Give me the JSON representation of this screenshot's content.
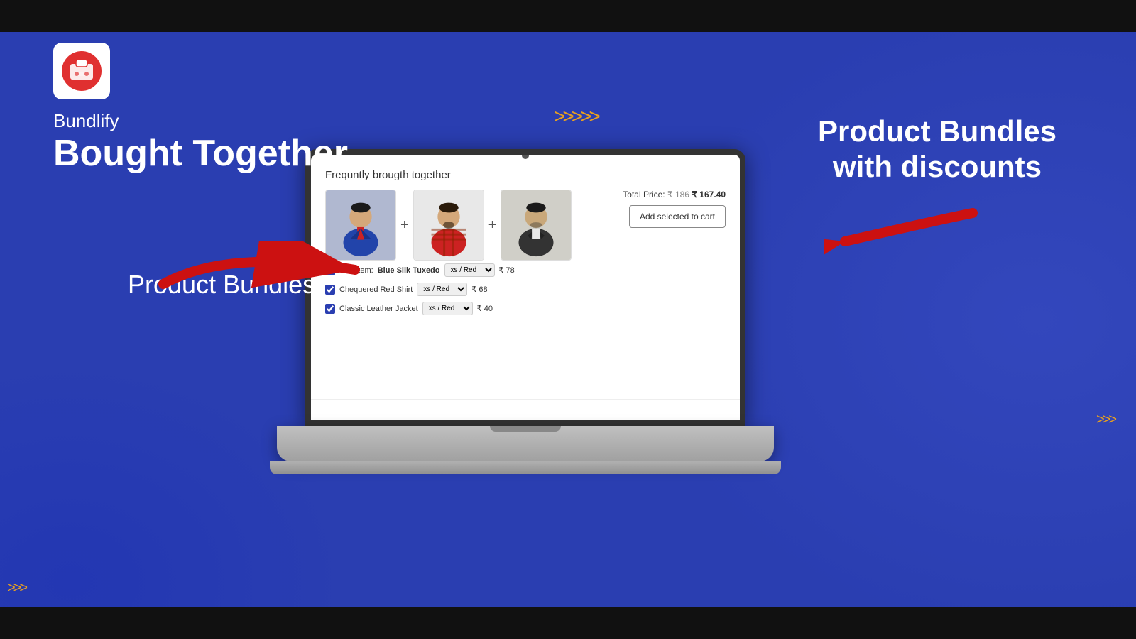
{
  "topBar": {},
  "bottomBar": {},
  "brand": {
    "name": "Bundlify",
    "boughtTogether": "Bought Together",
    "productBundles": "Product Bundles",
    "productBundlesDiscounts": "Product Bundles with discounts"
  },
  "chevrons": {
    "top": ">>>>>",
    "right": ">>>",
    "bottomLeft": ">>>"
  },
  "screen": {
    "title": "Frequntly brougth together",
    "totalPriceLabel": "Total Price:",
    "totalPriceOriginal": "₹ 186",
    "totalPriceDiscounted": "₹ 167.40",
    "addCartButton": "Add selected to cart",
    "items": [
      {
        "checked": true,
        "prefix": "This item:",
        "name": "Blue Silk Tuxedo",
        "variant": "xs / Red",
        "price": "₹ 78"
      },
      {
        "checked": true,
        "prefix": "",
        "name": "Chequered Red Shirt",
        "variant": "xs / Red",
        "price": "₹ 68"
      },
      {
        "checked": true,
        "prefix": "",
        "name": "Classic Leather Jacket",
        "variant": "xs / Red",
        "price": "₹ 40"
      }
    ]
  }
}
